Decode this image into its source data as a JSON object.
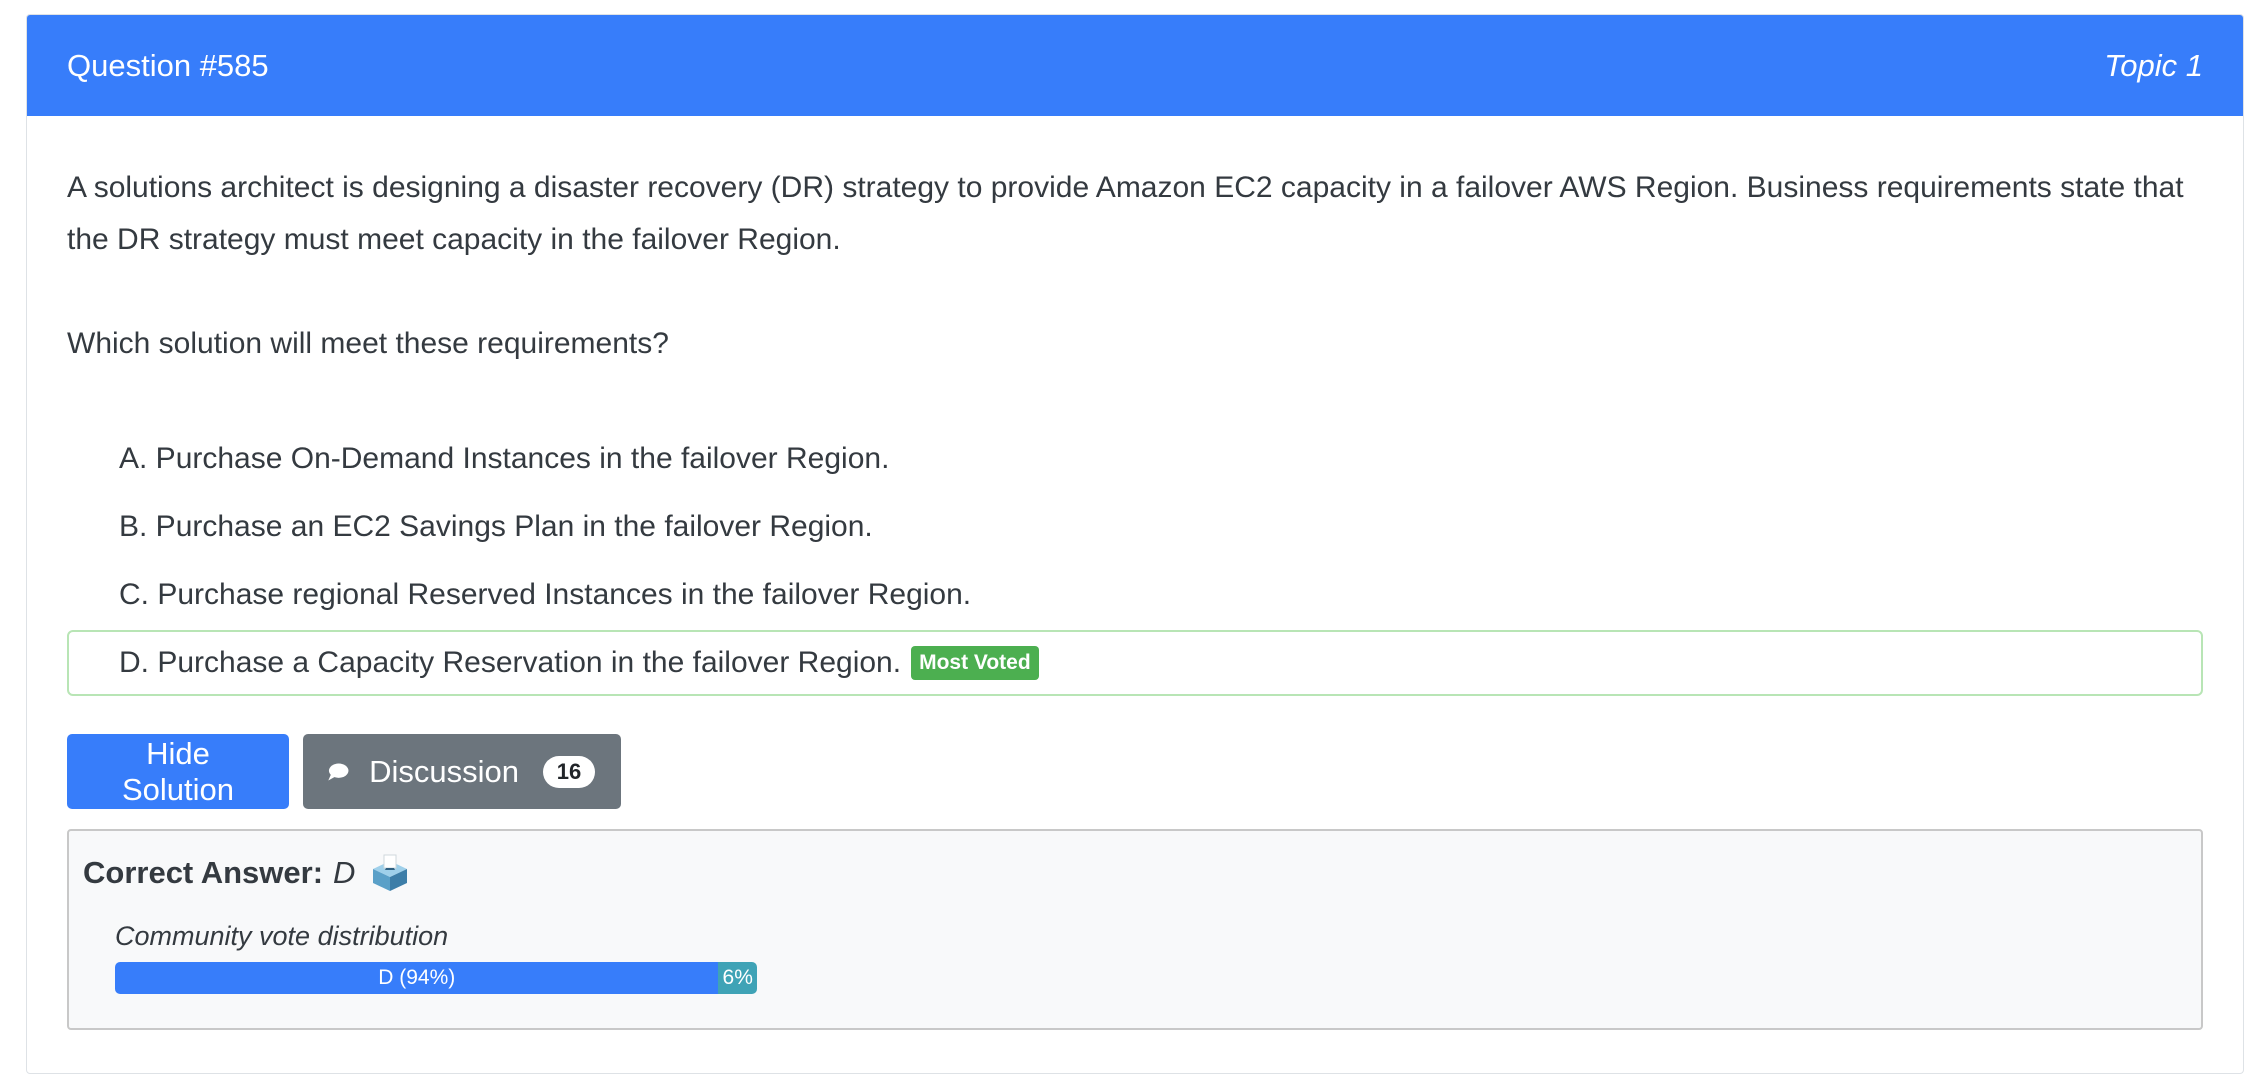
{
  "header": {
    "question": "Question #585",
    "topic": "Topic 1"
  },
  "question": {
    "text": "A solutions architect is designing a disaster recovery (DR) strategy to provide Amazon EC2 capacity in a failover AWS Region. Business requirements state that the DR strategy must meet capacity in the failover Region.",
    "ask": "Which solution will meet these requirements?"
  },
  "choices": [
    {
      "text": "A. Purchase On-Demand Instances in the failover Region."
    },
    {
      "text": "B. Purchase an EC2 Savings Plan in the failover Region."
    },
    {
      "text": "C. Purchase regional Reserved Instances in the failover Region."
    },
    {
      "text": "D. Purchase a Capacity Reservation in the failover Region.",
      "badge": "Most Voted"
    }
  ],
  "buttons": {
    "hide_solution": "Hide Solution",
    "discussion": "Discussion",
    "discussion_count": "16"
  },
  "answer": {
    "label": "Correct Answer:",
    "value": "D",
    "icon": "ballot-box-icon"
  },
  "votes": {
    "title": "Community vote distribution",
    "segments": [
      {
        "label": "D (94%)",
        "percent": 94,
        "color": "#377dfa"
      },
      {
        "label": "6%",
        "percent": 6,
        "color": "#3fa3b6"
      }
    ]
  },
  "colors": {
    "primary": "#377dfa",
    "secondary": "#6c757d",
    "success": "#4caf50",
    "correct_border": "#b8e5b5"
  }
}
